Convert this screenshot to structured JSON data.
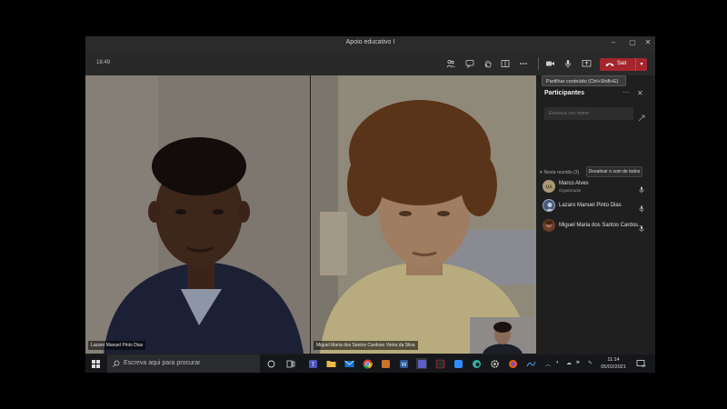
{
  "window": {
    "title": "Apoio educativo I"
  },
  "toolbar": {
    "time": "18:49",
    "leave_label": "Sair",
    "tooltip": "Partilhar conteúdo (Ctrl+Shift+E)"
  },
  "videos": {
    "left_label": "Lazaro Manuel Pinto Dias",
    "right_label": "Miguel Maria dos Santos Cardoso Vieira da Silva"
  },
  "panel": {
    "title": "Participantes",
    "search_placeholder": "Escreva um nome",
    "section_label": "Nesta reunião (3)",
    "mute_all_label": "Desativar o som de todos",
    "participants": [
      {
        "name": "Marco Alves",
        "role": "Organizador",
        "initials": "MA"
      },
      {
        "name": "Lazaro Manuel Pinto Dias",
        "role": ""
      },
      {
        "name": "Miguel Maria dos Santos Cardos...",
        "role": ""
      }
    ]
  },
  "taskbar": {
    "search_placeholder": "Escreva aqui para procurar",
    "time": "11:14",
    "date": "05/02/2021",
    "notification_count": "10"
  },
  "colors": {
    "leave": "#a4262c",
    "background": "#1f1f1f",
    "taskbar": "#16171a"
  }
}
